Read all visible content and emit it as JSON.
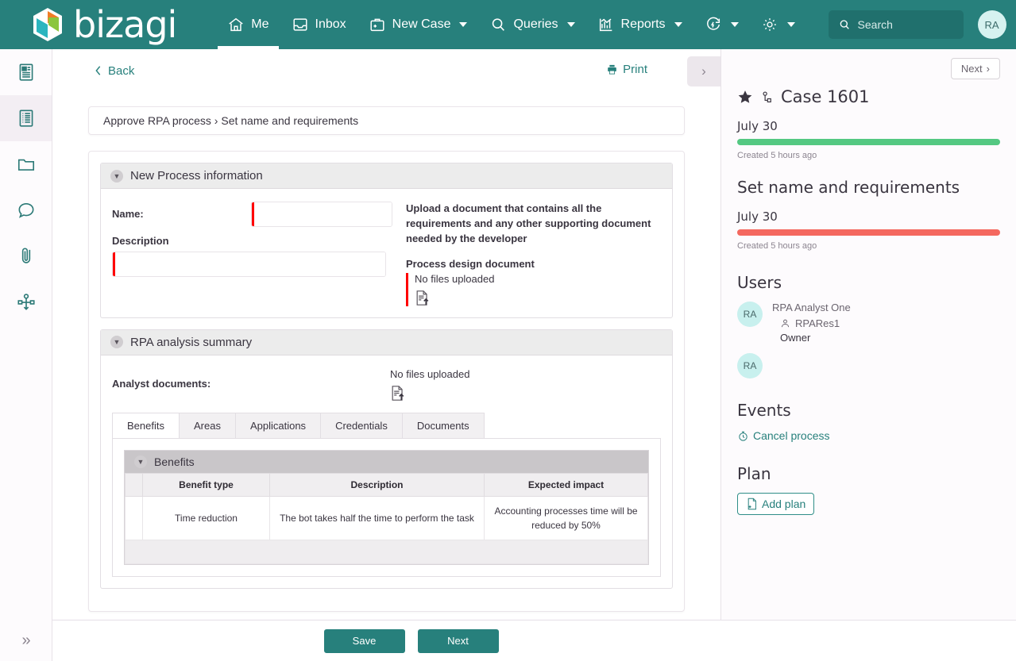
{
  "brand": {
    "name": "bizagi",
    "header_bg": "#27807c",
    "accent": "#27807c"
  },
  "header": {
    "nav": [
      {
        "label": "Me",
        "icon": "home-icon",
        "active": true,
        "caret": false
      },
      {
        "label": "Inbox",
        "icon": "inbox-icon",
        "active": false,
        "caret": false
      },
      {
        "label": "New Case",
        "icon": "briefcase-plus-icon",
        "active": false,
        "caret": true
      },
      {
        "label": "Queries",
        "icon": "search-icon",
        "active": false,
        "caret": true
      },
      {
        "label": "Reports",
        "icon": "chart-icon",
        "active": false,
        "caret": true
      },
      {
        "label": "",
        "icon": "refresh-icon",
        "active": false,
        "caret": true
      },
      {
        "label": "",
        "icon": "gear-icon",
        "active": false,
        "caret": true
      }
    ],
    "search": {
      "placeholder": "Search",
      "value": ""
    },
    "avatar": "RA"
  },
  "rail": {
    "items": [
      {
        "icon": "summary-icon",
        "active": false
      },
      {
        "icon": "form-icon",
        "active": true
      },
      {
        "icon": "folder-icon",
        "active": false
      },
      {
        "icon": "comment-icon",
        "active": false
      },
      {
        "icon": "attachment-icon",
        "active": false
      },
      {
        "icon": "process-diagram-icon",
        "active": false
      }
    ],
    "expand_label": "»"
  },
  "center": {
    "back_label": "Back",
    "print_label": "Print",
    "collapse_label": "›",
    "breadcrumb": "Approve RPA process › Set name and requirements",
    "new_process": {
      "title": "New Process information",
      "name_label": "Name:",
      "name_value": "",
      "description_label": "Description",
      "description_value": "",
      "upload_help": "Upload a document that contains all the requirements and any other supporting document needed by the developer",
      "upload_title": "Process design document",
      "no_files": "No files uploaded"
    },
    "rpa_summary": {
      "title": "RPA analysis summary",
      "analyst_label": "Analyst documents:",
      "no_files": "No files uploaded",
      "tabs": [
        {
          "label": "Benefits",
          "active": true
        },
        {
          "label": "Areas",
          "active": false
        },
        {
          "label": "Applications",
          "active": false
        },
        {
          "label": "Credentials",
          "active": false
        },
        {
          "label": "Documents",
          "active": false
        }
      ],
      "benefits_panel": {
        "title": "Benefits",
        "columns": [
          "Benefit type",
          "Description",
          "Expected impact"
        ],
        "rows": [
          {
            "benefit_type": "Time reduction",
            "description": "The bot takes half the time to perform the task",
            "expected_impact": "Accounting processes time will be reduced by 50%"
          }
        ]
      }
    }
  },
  "right": {
    "next_label": "Next",
    "case_title": "Case 1601",
    "stages": [
      {
        "date": "July 30",
        "bar_color": "#54c882",
        "meta": "Created 5 hours ago",
        "name": ""
      },
      {
        "name": "Set name and requirements",
        "date": "July 30",
        "bar_color": "#f4685f",
        "meta": "Created 5 hours ago"
      }
    ],
    "users_title": "Users",
    "users": [
      {
        "initials": "RA",
        "name": "RPA Analyst One",
        "login": "RPARes1",
        "role": "Owner"
      },
      {
        "initials": "RA",
        "name": "",
        "login": "",
        "role": ""
      }
    ],
    "events_title": "Events",
    "events": [
      {
        "label": "Cancel process",
        "icon": "timer-icon"
      }
    ],
    "plan_title": "Plan",
    "add_plan_label": "Add plan"
  },
  "footer": {
    "save_label": "Save",
    "next_label": "Next"
  }
}
